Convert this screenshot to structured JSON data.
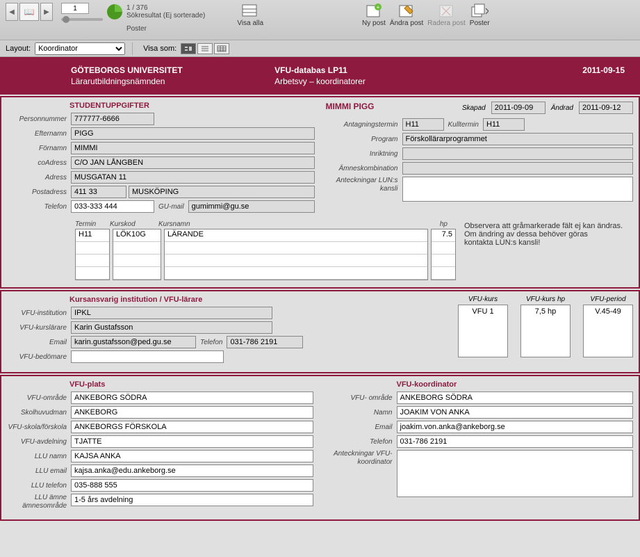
{
  "toolbar": {
    "record_current": "1",
    "record_total": "1 / 376",
    "search_result": "Sökresultat (Ej sorterade)",
    "poster": "Poster",
    "visa_alla": "Visa alla",
    "ny_post": "Ny post",
    "andra_post": "Ändra post",
    "radera_post": "Radera post",
    "poster2": "Poster"
  },
  "subbar": {
    "layout_label": "Layout:",
    "layout_value": "Koordinator",
    "visa_som": "Visa som:"
  },
  "header": {
    "org1": "GÖTEBORGS UNIVERSITET",
    "org2": "Lärarutbildningsnämnden",
    "app1": "VFU-databas LP11",
    "app2": "Arbetsvy – koordinatorer",
    "date": "2011-09-15"
  },
  "student": {
    "title": "STUDENTUPPGIFTER",
    "name_header": "MIMMI PIGG",
    "skapad_label": "Skapad",
    "skapad": "2011-09-09",
    "andrad_label": "Ändrad",
    "andrad": "2011-09-12",
    "personnummer_label": "Personnummer",
    "personnummer": "777777-6666",
    "efternamn_label": "Efternamn",
    "efternamn": "PIGG",
    "fornamn_label": "Förnamn",
    "fornamn": "MIMMI",
    "coadress_label": "coAdress",
    "coadress": "C/O JAN LÅNGBEN",
    "adress_label": "Adress",
    "adress": "MUSGATAN 11",
    "postadress_label": "Postadress",
    "postnr": "411 33",
    "postort": "MUSKÖPING",
    "telefon_label": "Telefon",
    "telefon": "033-333 444",
    "gumail_label": "GU-mail",
    "gumail": "gumimmi@gu.se",
    "antagningstermin_label": "Antagningstermin",
    "antagningstermin": "H11",
    "kulltermin_label": "Kulltermin",
    "kulltermin": "H11",
    "program_label": "Program",
    "program": "Förskollärarprogrammet",
    "inriktning_label": "Inriktning",
    "inriktning": "",
    "amneskombination_label": "Ämneskombination",
    "amneskombination": "",
    "anteckningar_label": "Anteckningar LUN:s kansli",
    "anteckningar": "",
    "course_headers": {
      "termin": "Termin",
      "kurskod": "Kurskod",
      "kursnamn": "Kursnamn",
      "hp": "hp"
    },
    "course": {
      "termin": "H11",
      "kurskod": "LÖK10G",
      "kursnamn": "LÄRANDE",
      "hp": "7.5"
    },
    "note_l1": "Observera att gråmarkerade fält ej kan ändras.",
    "note_l2": "Om ändring av dessa behöver göras",
    "note_l3": "kontakta LUN:s kansli!"
  },
  "kurs": {
    "title": "Kursansvarig institution / VFU-lärare",
    "institution_label": "VFU-institution",
    "institution": "IPKL",
    "kurslarare_label": "VFU-kurslärare",
    "kurslarare": "Karin Gustafsson",
    "email_label": "Email",
    "email": "karin.gustafsson@ped.gu.se",
    "telefon_label": "Telefon",
    "telefon": "031-786 2191",
    "bedomare_label": "VFU-bedömare",
    "bedomare": "",
    "vfu_kurs_label": "VFU-kurs",
    "vfu_kurs": "VFU 1",
    "vfu_hp_label": "VFU-kurs hp",
    "vfu_hp": "7,5 hp",
    "vfu_period_label": "VFU-period",
    "vfu_period": "V.45-49"
  },
  "plats": {
    "title": "VFU-plats",
    "omrade_label": "VFU-område",
    "omrade": "ANKEBORG SÖDRA",
    "huvudman_label": "Skolhuvudman",
    "huvudman": "ANKEBORG",
    "skola_label": "VFU-skola/förskola",
    "skola": "ANKEBORGS FÖRSKOLA",
    "avdelning_label": "VFU-avdelning",
    "avdelning": "TJATTE",
    "llu_namn_label": "LLU namn",
    "llu_namn": "KAJSA ANKA",
    "llu_email_label": "LLU email",
    "llu_email": "kajsa.anka@edu.ankeborg.se",
    "llu_tel_label": "LLU telefon",
    "llu_tel": "035-888 555",
    "llu_amne_label": "LLU ämne ämnesområde",
    "llu_amne": "1-5 års avdelning"
  },
  "koord": {
    "title": "VFU-koordinator",
    "omrade_label": "VFU- område",
    "omrade": "ANKEBORG SÖDRA",
    "namn_label": "Namn",
    "namn": "JOAKIM VON ANKA",
    "email_label": "Email",
    "email": "joakim.von.anka@ankeborg.se",
    "telefon_label": "Telefon",
    "telefon": "031-786 2191",
    "anteckningar_label": "Anteckningar VFU-koordinator",
    "anteckningar": ""
  }
}
